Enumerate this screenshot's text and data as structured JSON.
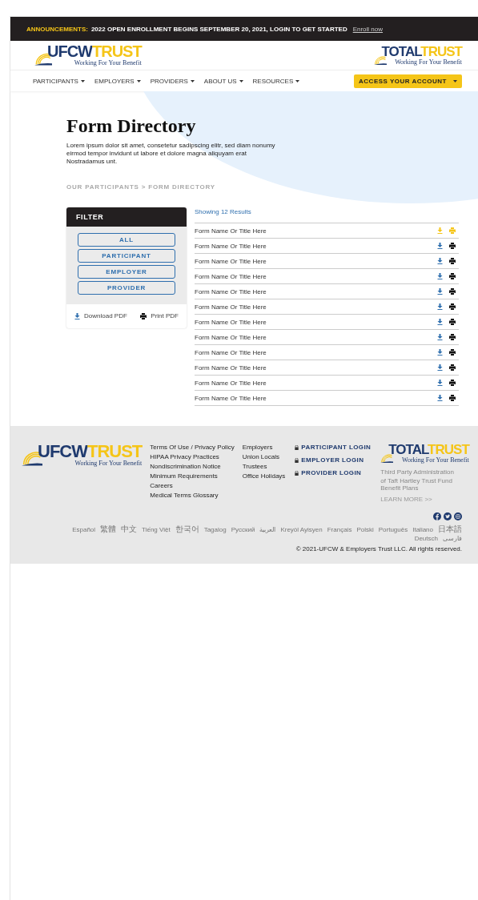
{
  "announcement": {
    "label": "ANNOUNCEMENTS:",
    "message": "2022 OPEN ENROLLMENT BEGINS SEPTEMBER 20, 2021, LOGIN TO GET STARTED",
    "link": "Enroll now"
  },
  "header": {
    "logo_left": {
      "primary": "UFCW",
      "accent": "TRUST",
      "tagline": "Working For Your Benefit"
    },
    "logo_right": {
      "primary": "TOTAL",
      "accent": "TRUST",
      "tagline": "Working For Your Benefit"
    }
  },
  "nav": {
    "items": [
      "PARTICIPANTS",
      "EMPLOYERS",
      "PROVIDERS",
      "ABOUT US",
      "RESOURCES"
    ],
    "account_button": "ACCESS YOUR ACCOUNT"
  },
  "hero": {
    "title": "Form Directory",
    "description": "Lorem ipsum dolor sit amet, consetetur sadipscing elitr, sed diam nonumy eirmod tempor invidunt ut labore et dolore magna aliquyam erat Nostradamus unt.",
    "breadcrumb": "OUR PARTICIPANTS > FORM DIRECTORY"
  },
  "filter": {
    "title": "FILTER",
    "options": [
      "ALL",
      "PARTICIPANT",
      "EMPLOYER",
      "PROVIDER"
    ],
    "actions": [
      {
        "kind": "download",
        "label": "Download PDF"
      },
      {
        "kind": "print",
        "label": "Print PDF"
      }
    ]
  },
  "results": {
    "summary": "Showing 12 Results",
    "rows": [
      {
        "title": "Form Name Or Title Here",
        "highlighted": true
      },
      {
        "title": "Form Name Or Title Here",
        "highlighted": false
      },
      {
        "title": "Form Name Or Title Here",
        "highlighted": false
      },
      {
        "title": "Form Name Or Title Here",
        "highlighted": false
      },
      {
        "title": "Form Name Or Title Here",
        "highlighted": false
      },
      {
        "title": "Form Name Or Title Here",
        "highlighted": false
      },
      {
        "title": "Form Name Or Title Here",
        "highlighted": false
      },
      {
        "title": "Form Name Or Title Here",
        "highlighted": false
      },
      {
        "title": "Form Name Or Title Here",
        "highlighted": false
      },
      {
        "title": "Form Name Or Title Here",
        "highlighted": false
      },
      {
        "title": "Form Name Or Title Here",
        "highlighted": false
      },
      {
        "title": "Form Name Or Title Here",
        "highlighted": false
      }
    ]
  },
  "footer": {
    "logo": {
      "primary": "UFCW",
      "accent": "TRUST",
      "tagline": "Working For Your Benefit"
    },
    "links_col1": [
      "Terms Of Use / Privacy Policy",
      "HIPAA Privacy Practices",
      "Nondiscrimination Notice",
      "Minimum Requirements",
      "Careers",
      "Medical Terms Glossary"
    ],
    "links_col2": [
      "Employers",
      "Union Locals",
      "Trustees",
      "Office Holidays"
    ],
    "logins": [
      "PARTICIPANT LOGIN",
      "EMPLOYER LOGIN",
      "PROVIDER LOGIN"
    ],
    "total_trust": {
      "logo": {
        "primary": "TOTAL",
        "accent": "TRUST",
        "tagline": "Working For Your Benefit"
      },
      "line1": "Third Party Administration",
      "line2": "of Taft Hartley Trust Fund Benefit Plans",
      "learn_more": "LEARN MORE >>"
    },
    "languages": [
      "Español",
      "繁體",
      "中文",
      "Tiếng Việt",
      "한국어",
      "Tagalog",
      "Русский",
      "العربية",
      "Kreyòl Ayisyen",
      "Français",
      "Polski",
      "Português",
      "Italiano",
      "日本語",
      "Deutsch",
      "فارسی"
    ],
    "copyright": "© 2021-UFCW & Employers Trust LLC. All rights reserved."
  }
}
